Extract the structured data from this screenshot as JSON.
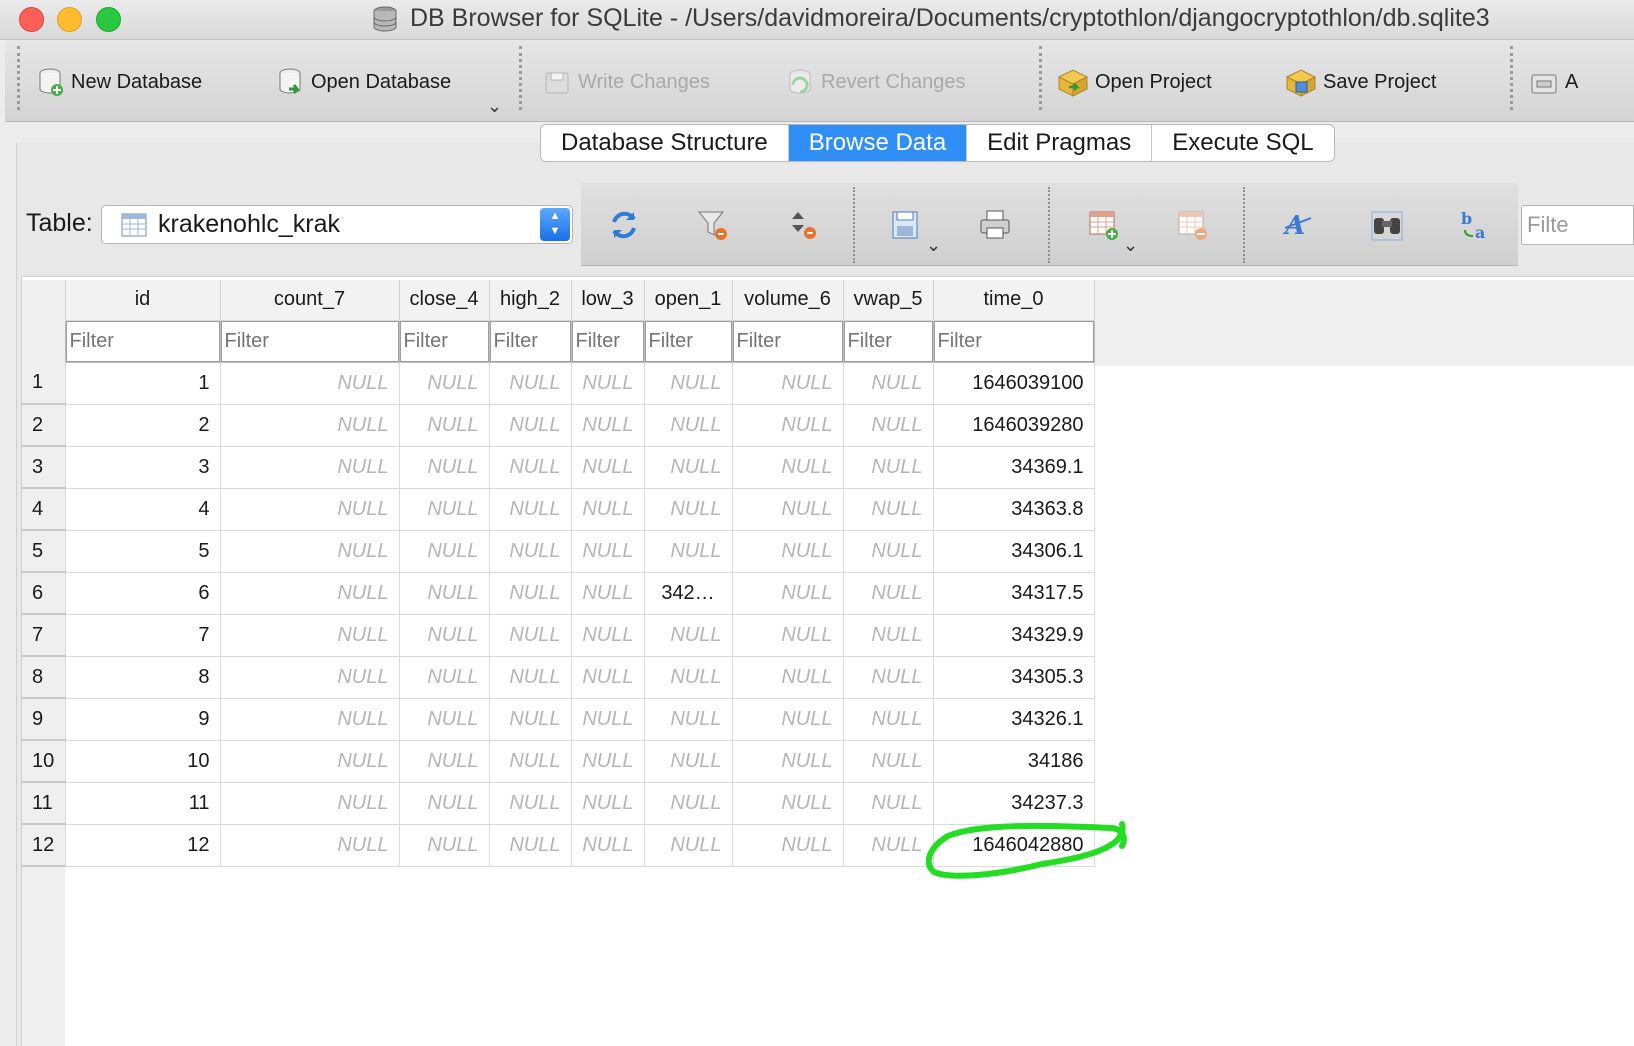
{
  "window": {
    "title": "DB Browser for SQLite - /Users/davidmoreira/Documents/cryptothlon/djangocryptothlon/db.sqlite3"
  },
  "toolbar": {
    "new_database": "New Database",
    "open_database": "Open Database",
    "write_changes": "Write Changes",
    "revert_changes": "Revert Changes",
    "open_project": "Open Project",
    "save_project": "Save Project",
    "overflow_label": "A"
  },
  "tabs": [
    {
      "label": "Database Structure",
      "active": false
    },
    {
      "label": "Browse Data",
      "active": true
    },
    {
      "label": "Edit Pragmas",
      "active": false
    },
    {
      "label": "Execute SQL",
      "active": false
    }
  ],
  "browse": {
    "table_label": "Table:",
    "table_selected": "krakenohlc_krak",
    "filter_search_placeholder": "Filte"
  },
  "grid": {
    "columns": [
      "id",
      "count_7",
      "close_4",
      "high_2",
      "low_3",
      "open_1",
      "volume_6",
      "vwap_5",
      "time_0"
    ],
    "filter_placeholder": "Filter",
    "null_text": "NULL",
    "row_numbers": [
      "1",
      "2",
      "3",
      "4",
      "5",
      "6",
      "7",
      "8",
      "9",
      "10",
      "11",
      "12"
    ],
    "rows": [
      [
        "1",
        "NULL",
        "NULL",
        "NULL",
        "NULL",
        "NULL",
        "NULL",
        "NULL",
        "1646039100"
      ],
      [
        "2",
        "NULL",
        "NULL",
        "NULL",
        "NULL",
        "NULL",
        "NULL",
        "NULL",
        "1646039280"
      ],
      [
        "3",
        "NULL",
        "NULL",
        "NULL",
        "NULL",
        "NULL",
        "NULL",
        "NULL",
        "34369.1"
      ],
      [
        "4",
        "NULL",
        "NULL",
        "NULL",
        "NULL",
        "NULL",
        "NULL",
        "NULL",
        "34363.8"
      ],
      [
        "5",
        "NULL",
        "NULL",
        "NULL",
        "NULL",
        "NULL",
        "NULL",
        "NULL",
        "34306.1"
      ],
      [
        "6",
        "NULL",
        "NULL",
        "NULL",
        "NULL",
        "342…",
        "NULL",
        "NULL",
        "34317.5"
      ],
      [
        "7",
        "NULL",
        "NULL",
        "NULL",
        "NULL",
        "NULL",
        "NULL",
        "NULL",
        "34329.9"
      ],
      [
        "8",
        "NULL",
        "NULL",
        "NULL",
        "NULL",
        "NULL",
        "NULL",
        "NULL",
        "34305.3"
      ],
      [
        "9",
        "NULL",
        "NULL",
        "NULL",
        "NULL",
        "NULL",
        "NULL",
        "NULL",
        "34326.1"
      ],
      [
        "10",
        "NULL",
        "NULL",
        "NULL",
        "NULL",
        "NULL",
        "NULL",
        "NULL",
        "34186"
      ],
      [
        "11",
        "NULL",
        "NULL",
        "NULL",
        "NULL",
        "NULL",
        "NULL",
        "NULL",
        "34237.3"
      ],
      [
        "12",
        "NULL",
        "NULL",
        "NULL",
        "NULL",
        "NULL",
        "NULL",
        "NULL",
        "1646042880"
      ]
    ]
  },
  "annotation": {
    "color": "#22dd22"
  }
}
